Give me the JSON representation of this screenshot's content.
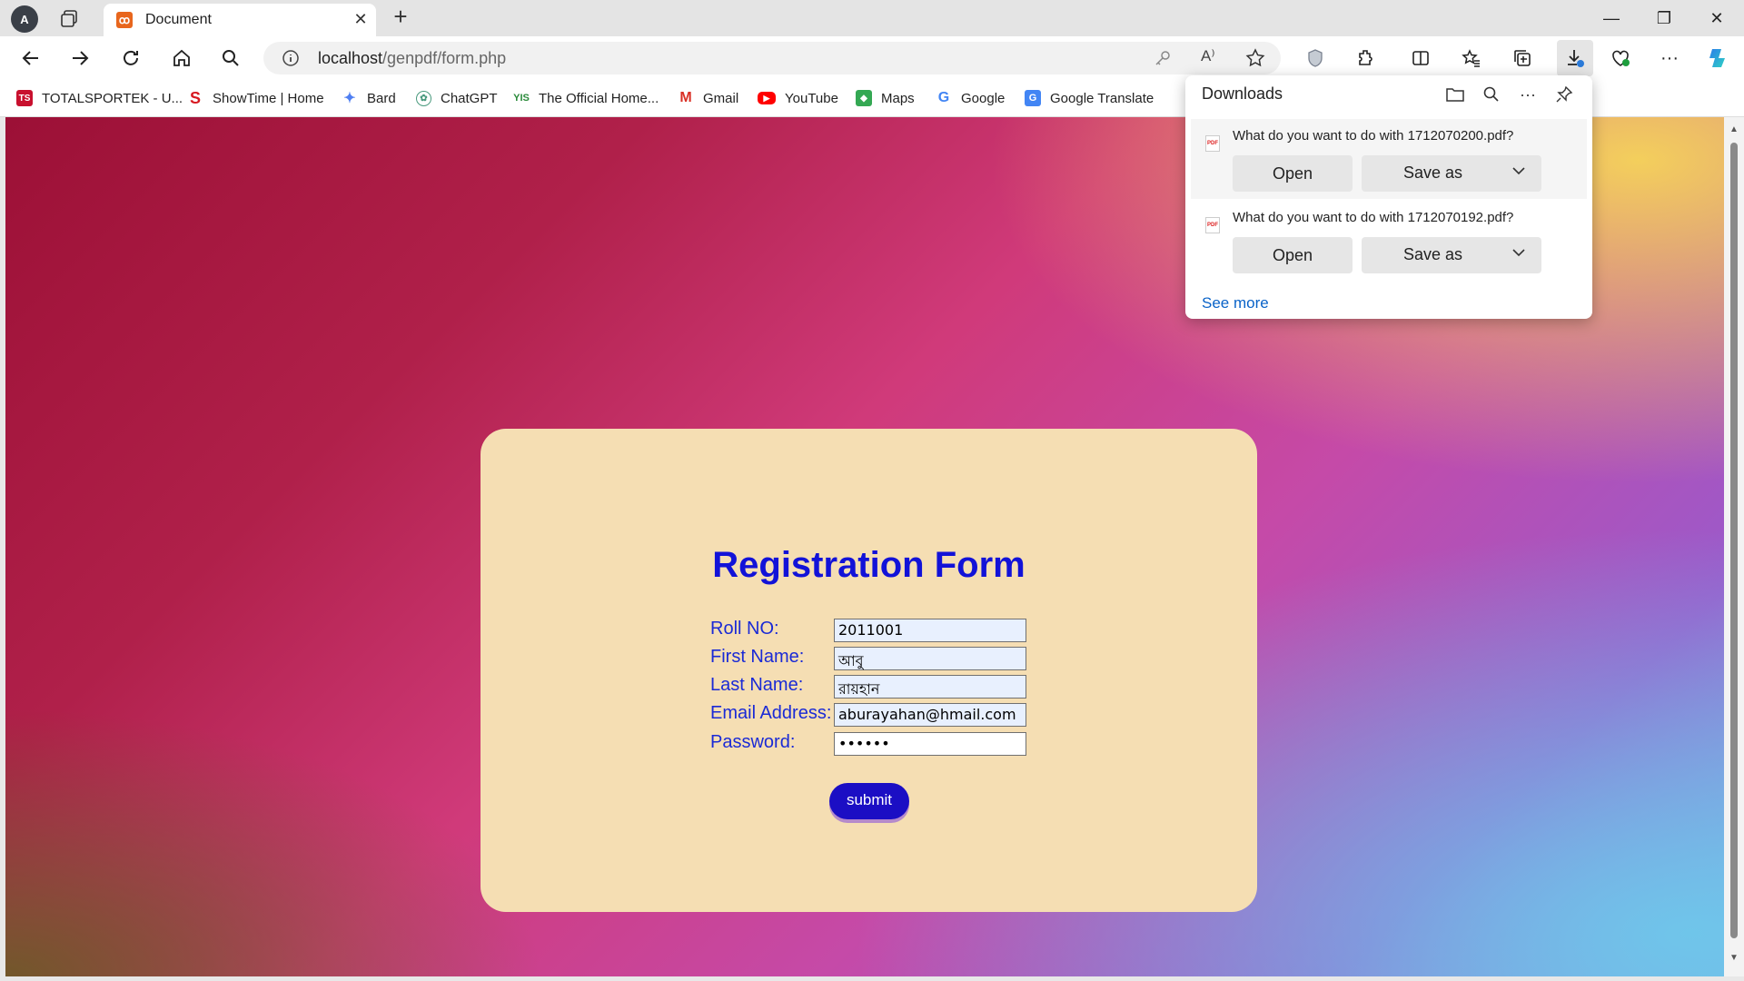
{
  "browser": {
    "tab_title": "Document",
    "url_host": "localhost",
    "url_path": "/genpdf/form.php"
  },
  "bookmarks": [
    {
      "label": "TOTALSPORTEK - U...",
      "icon": "ts-logo-icon",
      "color": "#c8102e"
    },
    {
      "label": "ShowTime | Home",
      "icon": "showtime-icon",
      "color": "#d71920"
    },
    {
      "label": "Bard",
      "icon": "bard-sparkle-icon",
      "color": "#4f7ff2"
    },
    {
      "label": "ChatGPT",
      "icon": "chatgpt-icon",
      "color": "#4a9a7e"
    },
    {
      "label": "The Official Home...",
      "icon": "official-home-icon",
      "color": "#2a8a3a"
    },
    {
      "label": "Gmail",
      "icon": "gmail-icon",
      "color": "#d93025"
    },
    {
      "label": "YouTube",
      "icon": "youtube-icon",
      "color": "#ff0000"
    },
    {
      "label": "Maps",
      "icon": "maps-icon",
      "color": "#34a853"
    },
    {
      "label": "Google",
      "icon": "google-icon",
      "color": "#4285f4"
    },
    {
      "label": "Google Translate",
      "icon": "google-translate-icon",
      "color": "#4285f4"
    }
  ],
  "form": {
    "title": "Registration Form",
    "fields": [
      {
        "label": "Roll NO:",
        "value": "2011001"
      },
      {
        "label": "First Name:",
        "value": "আবু"
      },
      {
        "label": "Last Name:",
        "value": "রায়হান"
      },
      {
        "label": "Email Address:",
        "value": "aburayahan@hmail.com"
      },
      {
        "label": "Password:",
        "value": "••••••"
      }
    ],
    "submit_label": "submit"
  },
  "downloads": {
    "title": "Downloads",
    "items": [
      {
        "question": "What do you want to do with 1712070200.pdf?",
        "open_label": "Open",
        "save_label": "Save as"
      },
      {
        "question": "What do you want to do with 1712070192.pdf?",
        "open_label": "Open",
        "save_label": "Save as"
      }
    ],
    "see_more": "See more"
  },
  "colors": {
    "form_title": "#1212d8",
    "form_label": "#1a2ad6",
    "card_bg": "#f5deb3",
    "submit_bg": "#1b0ec4",
    "link": "#0a63c8"
  }
}
